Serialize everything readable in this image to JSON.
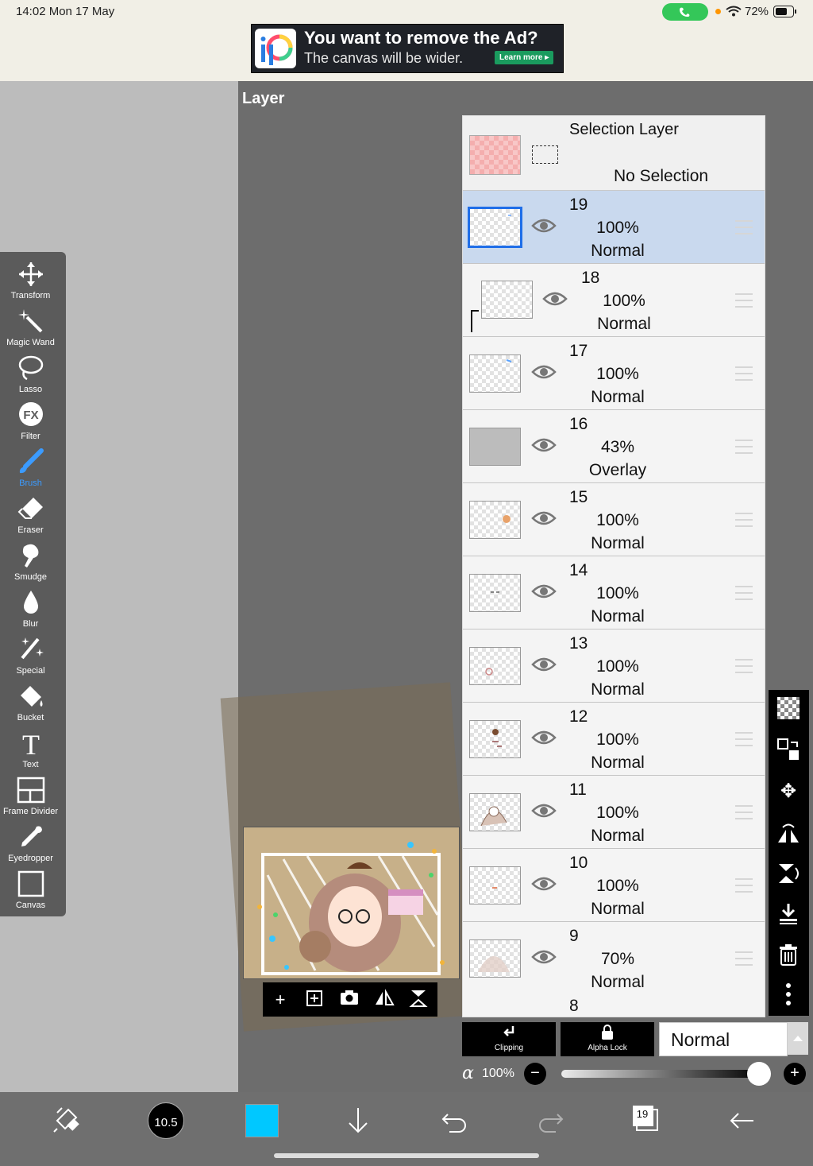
{
  "status": {
    "time": "14:02  Mon 17 May",
    "battery": "72%",
    "battery_level": 0.72
  },
  "ad": {
    "title": "You want to remove the Ad?",
    "subtitle": "The canvas will be wider.",
    "button": "Learn more ▸"
  },
  "panel": {
    "title": "Layer"
  },
  "tools": [
    {
      "label": "Transform",
      "icon": "move-arrows-icon"
    },
    {
      "label": "Magic Wand",
      "icon": "magic-wand-icon"
    },
    {
      "label": "Lasso",
      "icon": "lasso-icon"
    },
    {
      "label": "Filter",
      "icon": "fx-filter-icon"
    },
    {
      "label": "Brush",
      "icon": "brush-icon",
      "active": true
    },
    {
      "label": "Eraser",
      "icon": "eraser-icon"
    },
    {
      "label": "Smudge",
      "icon": "smudge-icon"
    },
    {
      "label": "Blur",
      "icon": "drop-icon"
    },
    {
      "label": "Special",
      "icon": "special-pen-icon"
    },
    {
      "label": "Bucket",
      "icon": "bucket-icon"
    },
    {
      "label": "Text",
      "icon": "text-icon"
    },
    {
      "label": "Frame Divider",
      "icon": "frame-divider-icon"
    },
    {
      "label": "Eyedropper",
      "icon": "eyedropper-icon"
    },
    {
      "label": "Canvas",
      "icon": "canvas-icon"
    }
  ],
  "selection_layer": {
    "title": "Selection Layer",
    "status": "No Selection"
  },
  "layers": [
    {
      "number": "19",
      "opacity": "100%",
      "mode": "Normal",
      "selected": true,
      "clipped": false
    },
    {
      "number": "18",
      "opacity": "100%",
      "mode": "Normal",
      "selected": false,
      "clipped": true
    },
    {
      "number": "17",
      "opacity": "100%",
      "mode": "Normal",
      "selected": false,
      "clipped": false
    },
    {
      "number": "16",
      "opacity": "43%",
      "mode": "Overlay",
      "selected": false,
      "clipped": false
    },
    {
      "number": "15",
      "opacity": "100%",
      "mode": "Normal",
      "selected": false,
      "clipped": false
    },
    {
      "number": "14",
      "opacity": "100%",
      "mode": "Normal",
      "selected": false,
      "clipped": false
    },
    {
      "number": "13",
      "opacity": "100%",
      "mode": "Normal",
      "selected": false,
      "clipped": false
    },
    {
      "number": "12",
      "opacity": "100%",
      "mode": "Normal",
      "selected": false,
      "clipped": false
    },
    {
      "number": "11",
      "opacity": "100%",
      "mode": "Normal",
      "selected": false,
      "clipped": false
    },
    {
      "number": "10",
      "opacity": "100%",
      "mode": "Normal",
      "selected": false,
      "clipped": false
    },
    {
      "number": "9",
      "opacity": "70%",
      "mode": "Normal",
      "selected": false,
      "clipped": false
    }
  ],
  "partial_layer": {
    "number": "8"
  },
  "blend": {
    "clipping_label": "Clipping",
    "alpha_lock_label": "Alpha Lock",
    "mode": "Normal"
  },
  "opacity": {
    "symbol": "α",
    "value": "100%",
    "level": 1.0
  },
  "bottom": {
    "brush_size": "10.5",
    "color": "#00c8ff",
    "layer_count": "19"
  },
  "colors": {
    "accent": "#1f6ee8",
    "selected_row": "#c9d9ee",
    "panel": "#6d6d6d"
  }
}
